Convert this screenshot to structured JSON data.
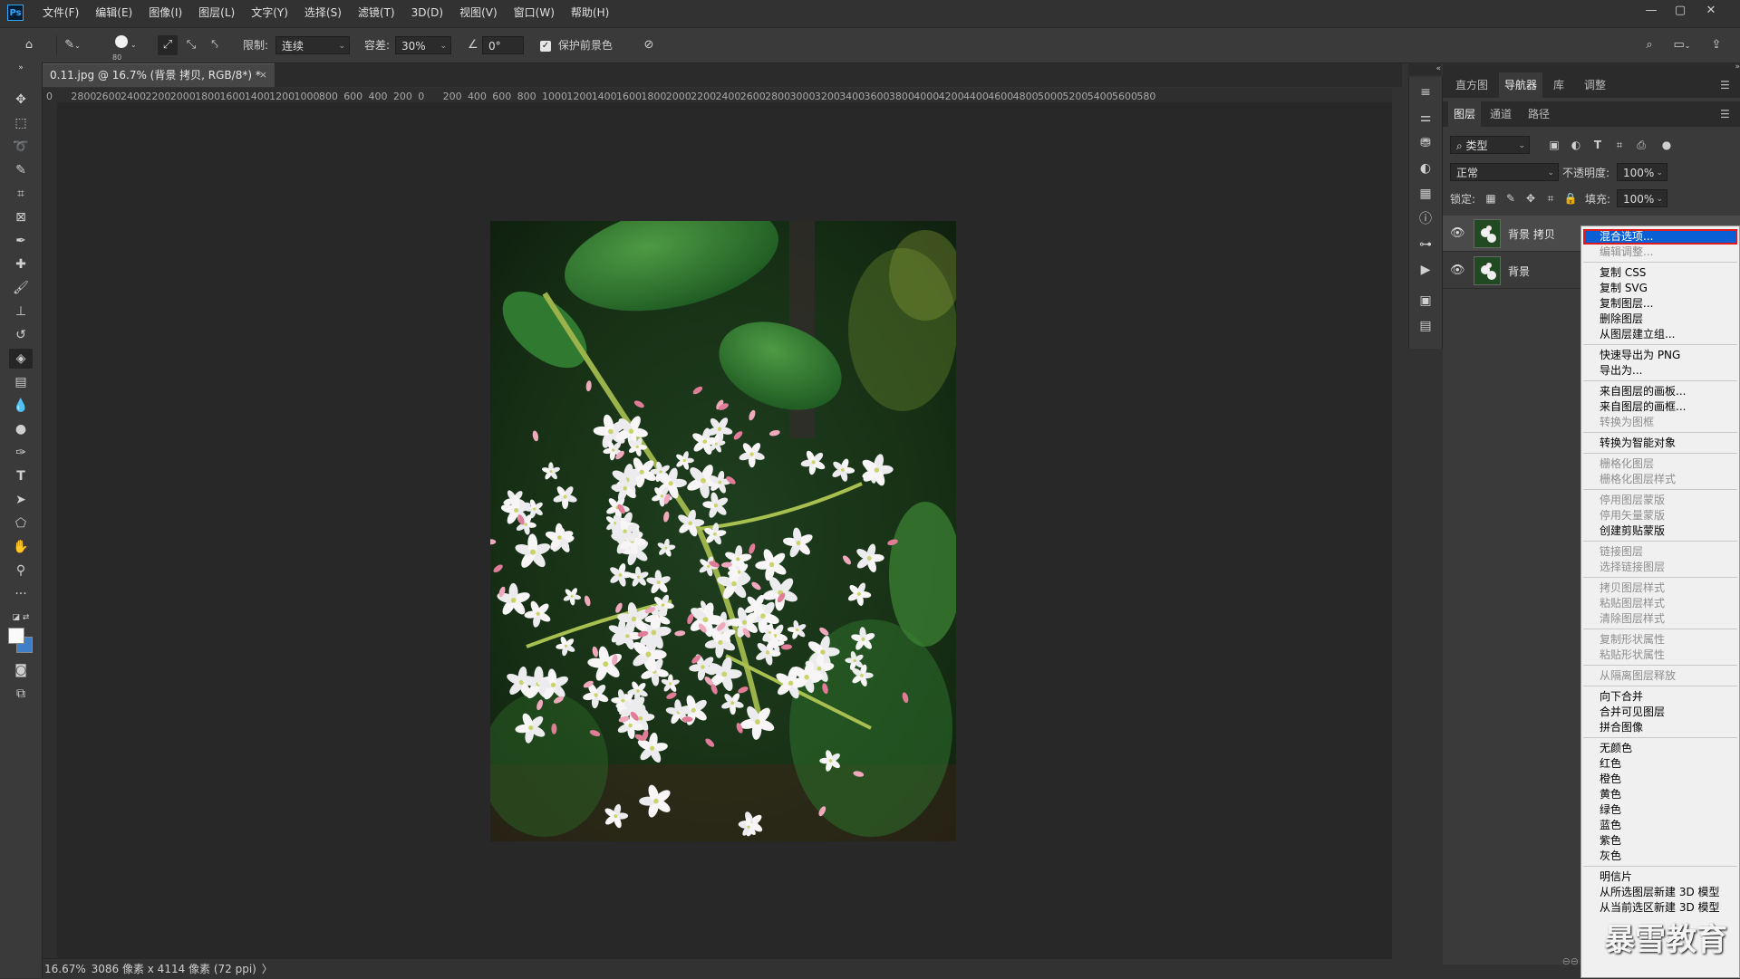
{
  "app": {
    "logo": "Ps",
    "menu": [
      "文件(F)",
      "编辑(E)",
      "图像(I)",
      "图层(L)",
      "文字(Y)",
      "选择(S)",
      "滤镜(T)",
      "3D(D)",
      "视图(V)",
      "窗口(W)",
      "帮助(H)"
    ],
    "window_controls": [
      "—",
      "▢",
      "✕"
    ]
  },
  "options": {
    "brush_size": "80",
    "limit_label": "限制:",
    "limit_value": "连续",
    "tolerance_label": "容差:",
    "tolerance_value": "30%",
    "angle_value": "0°",
    "protect_label": "保护前景色",
    "protect_checked": true
  },
  "document": {
    "tab_title": "0.11.jpg @ 16.7% (背景 拷贝, RGB/8*) *",
    "tab_close": "×",
    "ruler_h": [
      "0",
      "2800",
      "2600",
      "2400",
      "2200",
      "2000",
      "1800",
      "1600",
      "1400",
      "1200",
      "1000",
      "800",
      "600",
      "400",
      "200",
      "0",
      "200",
      "400",
      "600",
      "800",
      "1000",
      "1200",
      "1400",
      "1600",
      "1800",
      "2000",
      "2200",
      "2400",
      "2600",
      "2800",
      "3000",
      "3200",
      "3400",
      "3600",
      "3800",
      "4000",
      "4200",
      "4400",
      "4600",
      "4800",
      "5000",
      "5200",
      "5400",
      "5600",
      "580"
    ],
    "zoom": "16.67%",
    "size_info": "3086 像素 x 4114 像素 (72 ppi)",
    "status_arrow": "〉"
  },
  "panels": {
    "top_tabs": [
      "直方图",
      "导航器",
      "库",
      "调整"
    ],
    "top_active": "导航器",
    "layer_tabs": [
      "图层",
      "通道",
      "路径"
    ],
    "layer_active": "图层",
    "filter_kind": "类型",
    "blend_mode": "正常",
    "opacity_label": "不透明度:",
    "opacity_value": "100%",
    "lock_label": "锁定:",
    "fill_label": "填充:",
    "fill_value": "100%",
    "layers": [
      {
        "name": "背景 拷贝",
        "selected": true
      },
      {
        "name": "背景",
        "selected": false
      }
    ]
  },
  "context_menu": {
    "highlighted": "混合选项...",
    "groups": [
      [
        {
          "label": "混合选项...",
          "enabled": true
        },
        {
          "label": "编辑调整...",
          "enabled": false
        }
      ],
      [
        {
          "label": "复制 CSS",
          "enabled": true
        },
        {
          "label": "复制 SVG",
          "enabled": true
        },
        {
          "label": "复制图层...",
          "enabled": true
        },
        {
          "label": "删除图层",
          "enabled": true
        },
        {
          "label": "从图层建立组...",
          "enabled": true
        }
      ],
      [
        {
          "label": "快速导出为 PNG",
          "enabled": true
        },
        {
          "label": "导出为...",
          "enabled": true
        }
      ],
      [
        {
          "label": "来自图层的画板...",
          "enabled": true
        },
        {
          "label": "来自图层的画框...",
          "enabled": true
        },
        {
          "label": "转换为图框",
          "enabled": false
        }
      ],
      [
        {
          "label": "转换为智能对象",
          "enabled": true
        }
      ],
      [
        {
          "label": "栅格化图层",
          "enabled": false
        },
        {
          "label": "栅格化图层样式",
          "enabled": false
        }
      ],
      [
        {
          "label": "停用图层蒙版",
          "enabled": false
        },
        {
          "label": "停用矢量蒙版",
          "enabled": false
        },
        {
          "label": "创建剪贴蒙版",
          "enabled": true
        }
      ],
      [
        {
          "label": "链接图层",
          "enabled": false
        },
        {
          "label": "选择链接图层",
          "enabled": false
        }
      ],
      [
        {
          "label": "拷贝图层样式",
          "enabled": false
        },
        {
          "label": "粘贴图层样式",
          "enabled": false
        },
        {
          "label": "清除图层样式",
          "enabled": false
        }
      ],
      [
        {
          "label": "复制形状属性",
          "enabled": false
        },
        {
          "label": "粘贴形状属性",
          "enabled": false
        }
      ],
      [
        {
          "label": "从隔离图层释放",
          "enabled": false
        }
      ],
      [
        {
          "label": "向下合并",
          "enabled": true
        },
        {
          "label": "合并可见图层",
          "enabled": true
        },
        {
          "label": "拼合图像",
          "enabled": true
        }
      ],
      [
        {
          "label": "无颜色",
          "enabled": true
        },
        {
          "label": "红色",
          "enabled": true
        },
        {
          "label": "橙色",
          "enabled": true
        },
        {
          "label": "黄色",
          "enabled": true
        },
        {
          "label": "绿色",
          "enabled": true
        },
        {
          "label": "蓝色",
          "enabled": true
        },
        {
          "label": "紫色",
          "enabled": true
        },
        {
          "label": "灰色",
          "enabled": true
        }
      ],
      [
        {
          "label": "明信片",
          "enabled": true
        },
        {
          "label": "从所选图层新建 3D 模型",
          "enabled": true
        },
        {
          "label": "从当前选区新建 3D 模型",
          "enabled": true
        }
      ]
    ]
  },
  "watermark": "暴雪教育"
}
